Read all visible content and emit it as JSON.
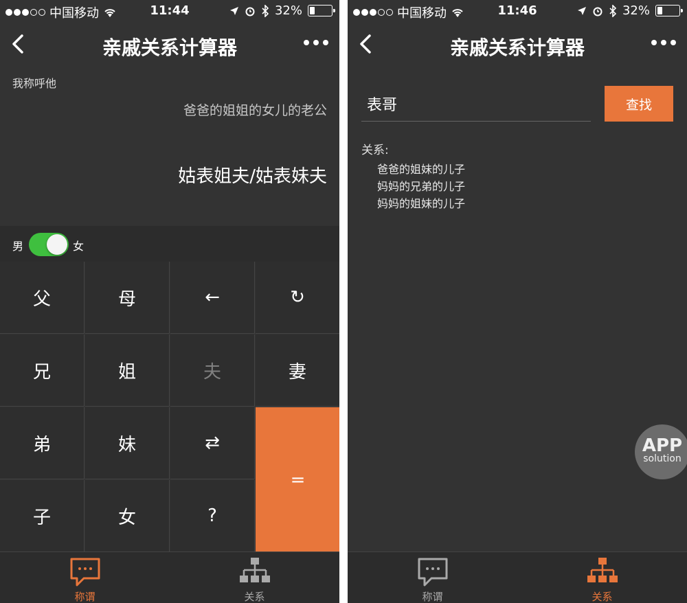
{
  "screens": [
    {
      "status": {
        "carrier": "中国移动",
        "time": "11:44",
        "battery": "32%",
        "battery_level": 0.32
      },
      "nav": {
        "title": "亲戚关系计算器"
      },
      "calculator": {
        "call_label": "我称呼他",
        "expression": "爸爸的姐姐的女儿的老公",
        "result": "姑表姐夫/姑表妹夫",
        "gender_male": "男",
        "gender_female": "女",
        "keys": [
          "父",
          "母",
          "←",
          "↻",
          "兄",
          "姐",
          "夫",
          "妻",
          "弟",
          "妹",
          "⇄",
          "=",
          "子",
          "女",
          "?"
        ]
      },
      "tabs": [
        {
          "label": "称谓",
          "active": true
        },
        {
          "label": "关系",
          "active": false
        }
      ]
    },
    {
      "status": {
        "carrier": "中国移动",
        "time": "11:46",
        "battery": "32%",
        "battery_level": 0.32
      },
      "nav": {
        "title": "亲戚关系计算器"
      },
      "search": {
        "value": "表哥",
        "button": "查找"
      },
      "relations": {
        "label": "关系:",
        "items": [
          "爸爸的姐妹的儿子",
          "妈妈的兄弟的儿子",
          "妈妈的姐妹的儿子"
        ]
      },
      "watermark": {
        "line1": "APP",
        "line2": "solution"
      },
      "tabs": [
        {
          "label": "称谓",
          "active": false
        },
        {
          "label": "关系",
          "active": true
        }
      ]
    }
  ],
  "colors": {
    "accent": "#e8763b",
    "background": "#333333",
    "toggle_on": "#3fbf3f",
    "inactive_tab": "#aaaaaa"
  }
}
